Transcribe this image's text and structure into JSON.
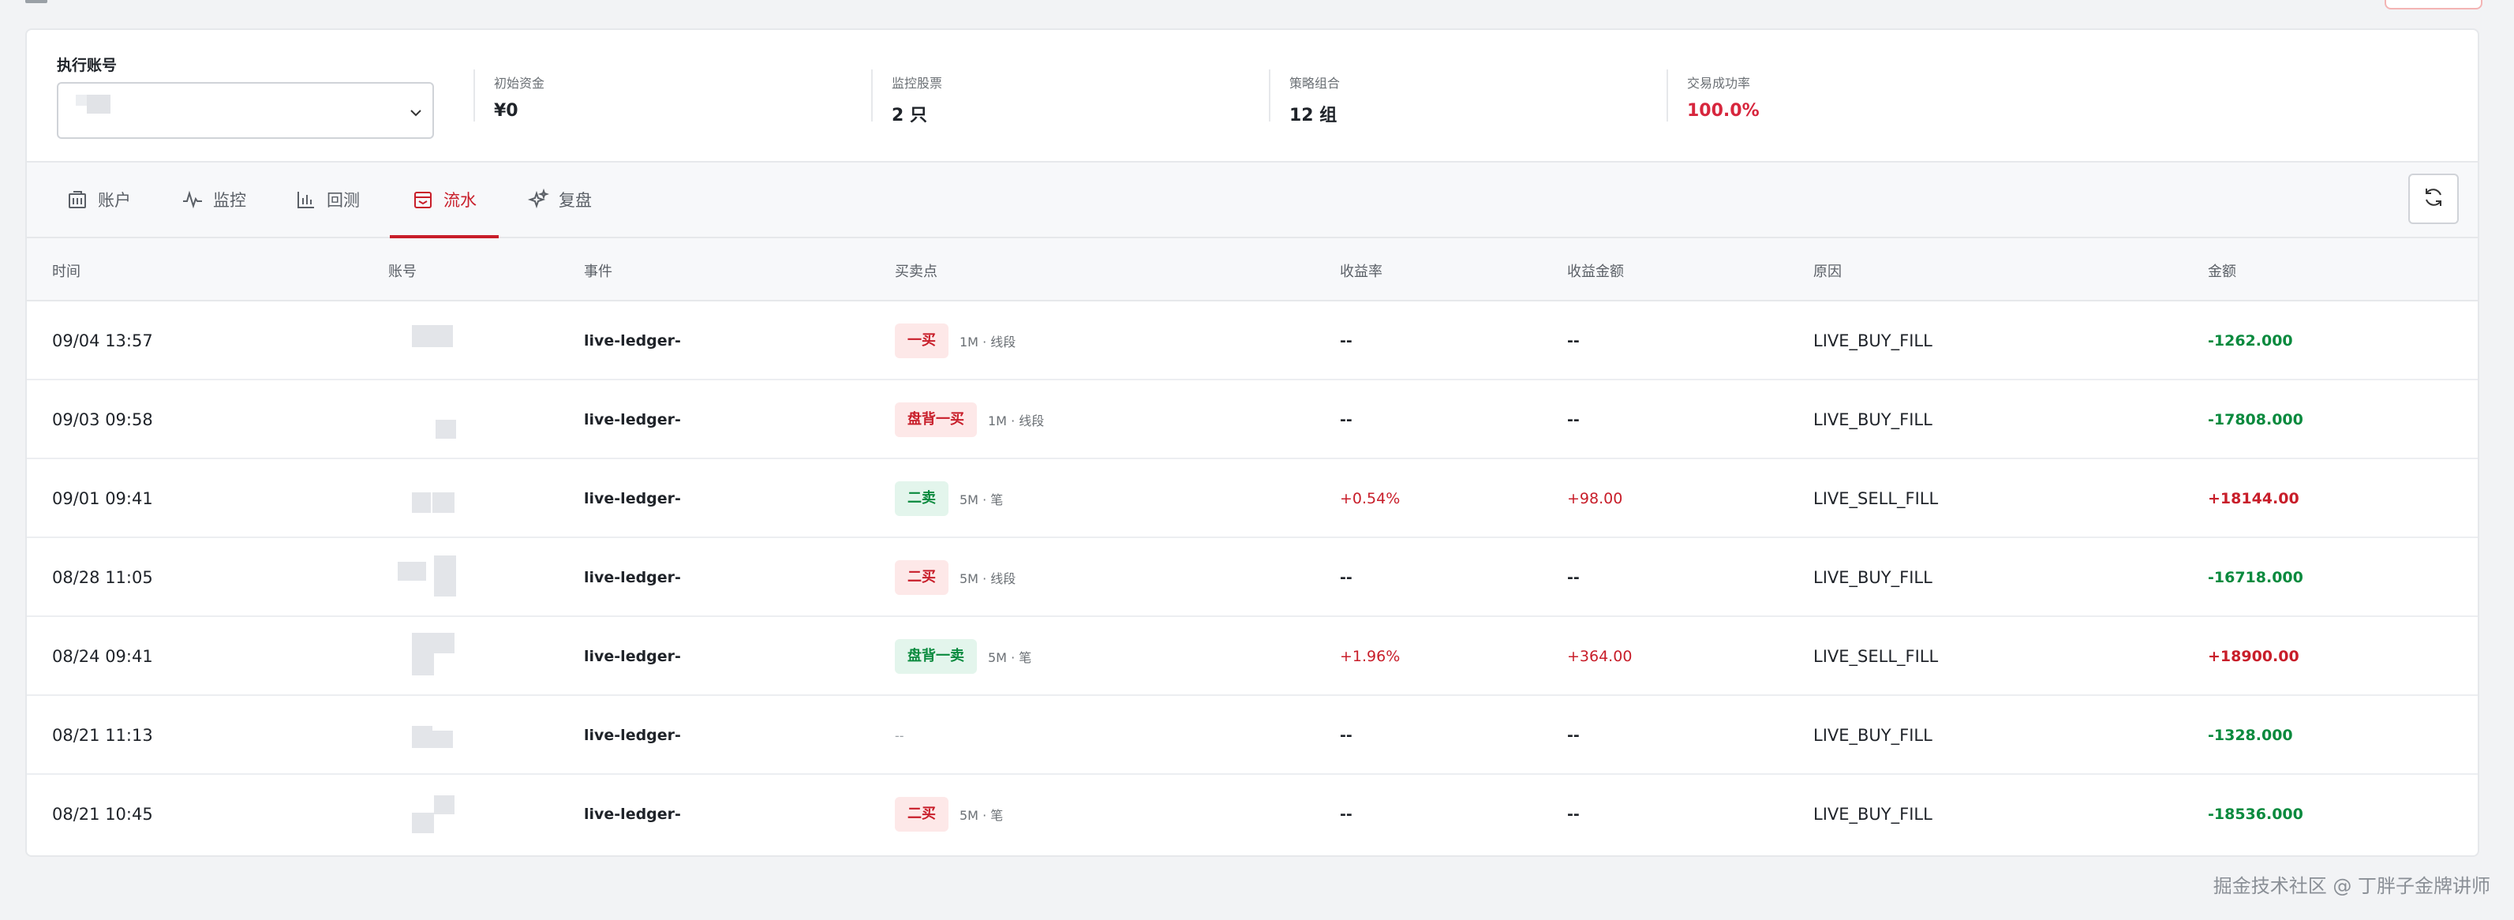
{
  "summary": {
    "account_label": "执行账号",
    "stats": [
      {
        "label": "初始资金",
        "value": "¥0"
      },
      {
        "label": "监控股票",
        "value": "2 只"
      },
      {
        "label": "策略组合",
        "value": "12 组"
      },
      {
        "label": "交易成功率",
        "value": "100.0%"
      }
    ]
  },
  "tabs": [
    {
      "label": "账户",
      "icon": "building-icon"
    },
    {
      "label": "监控",
      "icon": "pulse-icon"
    },
    {
      "label": "回测",
      "icon": "bar-chart-icon"
    },
    {
      "label": "流水",
      "icon": "ledger-icon",
      "active": true
    },
    {
      "label": "复盘",
      "icon": "sparkle-icon"
    }
  ],
  "table": {
    "headers": [
      "时间",
      "账号",
      "事件",
      "买卖点",
      "收益率",
      "收益金额",
      "原因",
      "金额"
    ],
    "rows": [
      {
        "time": "09/04 13:57",
        "event": "live-ledger-",
        "signal": "一买",
        "signal_type": "buy",
        "meta": "1M · 线段",
        "rate": "--",
        "profit": "--",
        "reason": "LIVE_BUY_FILL",
        "amount": "-1262.000",
        "amount_sign": "neg"
      },
      {
        "time": "09/03 09:58",
        "event": "live-ledger-",
        "signal": "盘背一买",
        "signal_type": "buy",
        "meta": "1M · 线段",
        "rate": "--",
        "profit": "--",
        "reason": "LIVE_BUY_FILL",
        "amount": "-17808.000",
        "amount_sign": "neg"
      },
      {
        "time": "09/01 09:41",
        "event": "live-ledger-",
        "signal": "二卖",
        "signal_type": "sell",
        "meta": "5M · 笔",
        "rate": "+0.54%",
        "profit": "+98.00",
        "reason": "LIVE_SELL_FILL",
        "amount": "+18144.00",
        "amount_sign": "pos"
      },
      {
        "time": "08/28 11:05",
        "event": "live-ledger-",
        "signal": "二买",
        "signal_type": "buy",
        "meta": "5M · 线段",
        "rate": "--",
        "profit": "--",
        "reason": "LIVE_BUY_FILL",
        "amount": "-16718.000",
        "amount_sign": "neg"
      },
      {
        "time": "08/24 09:41",
        "event": "live-ledger-",
        "signal": "盘背一卖",
        "signal_type": "sell",
        "meta": "5M · 笔",
        "rate": "+1.96%",
        "profit": "+364.00",
        "reason": "LIVE_SELL_FILL",
        "amount": "+18900.00",
        "amount_sign": "pos"
      },
      {
        "time": "08/21 11:13",
        "event": "live-ledger-",
        "signal": "",
        "signal_type": "none",
        "meta": "--",
        "rate": "--",
        "profit": "--",
        "reason": "LIVE_BUY_FILL",
        "amount": "-1328.000",
        "amount_sign": "neg"
      },
      {
        "time": "08/21 10:45",
        "event": "live-ledger-",
        "signal": "二买",
        "signal_type": "buy",
        "meta": "5M · 笔",
        "rate": "--",
        "profit": "--",
        "reason": "LIVE_BUY_FILL",
        "amount": "-18536.000",
        "amount_sign": "neg"
      }
    ]
  },
  "watermark": "掘金技术社区 @ 丁胖子金牌讲师",
  "colors": {
    "accent": "#c81e2a",
    "positive": "#c81e2a",
    "negative": "#0a8a3e"
  }
}
